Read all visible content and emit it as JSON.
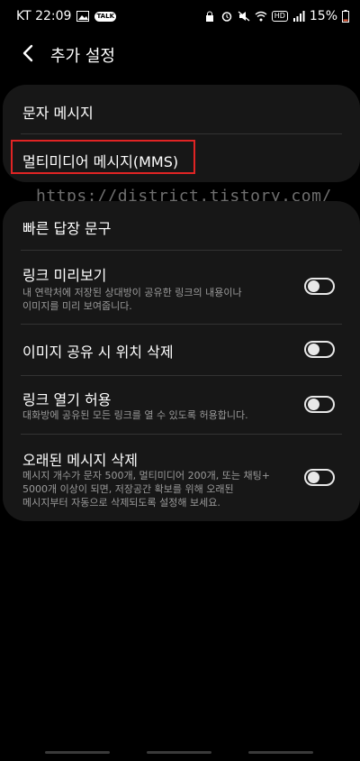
{
  "status_bar": {
    "carrier_time": "KT 22:09",
    "talk_badge": "TALK",
    "hd_badge": "HD",
    "battery": "15%"
  },
  "header": {
    "title": "추가 설정"
  },
  "card_messages": {
    "sms_label": "문자 메시지",
    "mms_label": "멀티미디어 메시지(MMS)"
  },
  "watermark": "https://district.tistory.com/",
  "settings": {
    "quick_reply": {
      "title": "빠른 답장 문구"
    },
    "link_preview": {
      "title": "링크 미리보기",
      "desc_line1": "내 연락처에 저장된 상대방이 공유한 링크의 내용이나",
      "desc_line2": "이미지를 미리 보여줍니다.",
      "enabled": false
    },
    "delete_location": {
      "title": "이미지 공유 시 위치 삭제",
      "enabled": false
    },
    "allow_link_open": {
      "title": "링크 열기 허용",
      "desc_line1": "대화방에 공유된 모든 링크를 열 수 있도록 허용합니다.",
      "enabled": false
    },
    "delete_old": {
      "title": "오래된 메시지 삭제",
      "desc_line1": "메시지 개수가 문자 500개, 멀티미디어 200개, 또는 채팅+",
      "desc_line2": "5000개 이상이 되면, 저장공간 확보를 위해 오래된",
      "desc_line3": "메시지부터 자동으로 삭제되도록 설정해 보세요.",
      "enabled": false
    }
  },
  "colors": {
    "background": "#000000",
    "card": "#171717",
    "highlight": "#e02424",
    "secondary_text": "#9a9a9a"
  }
}
